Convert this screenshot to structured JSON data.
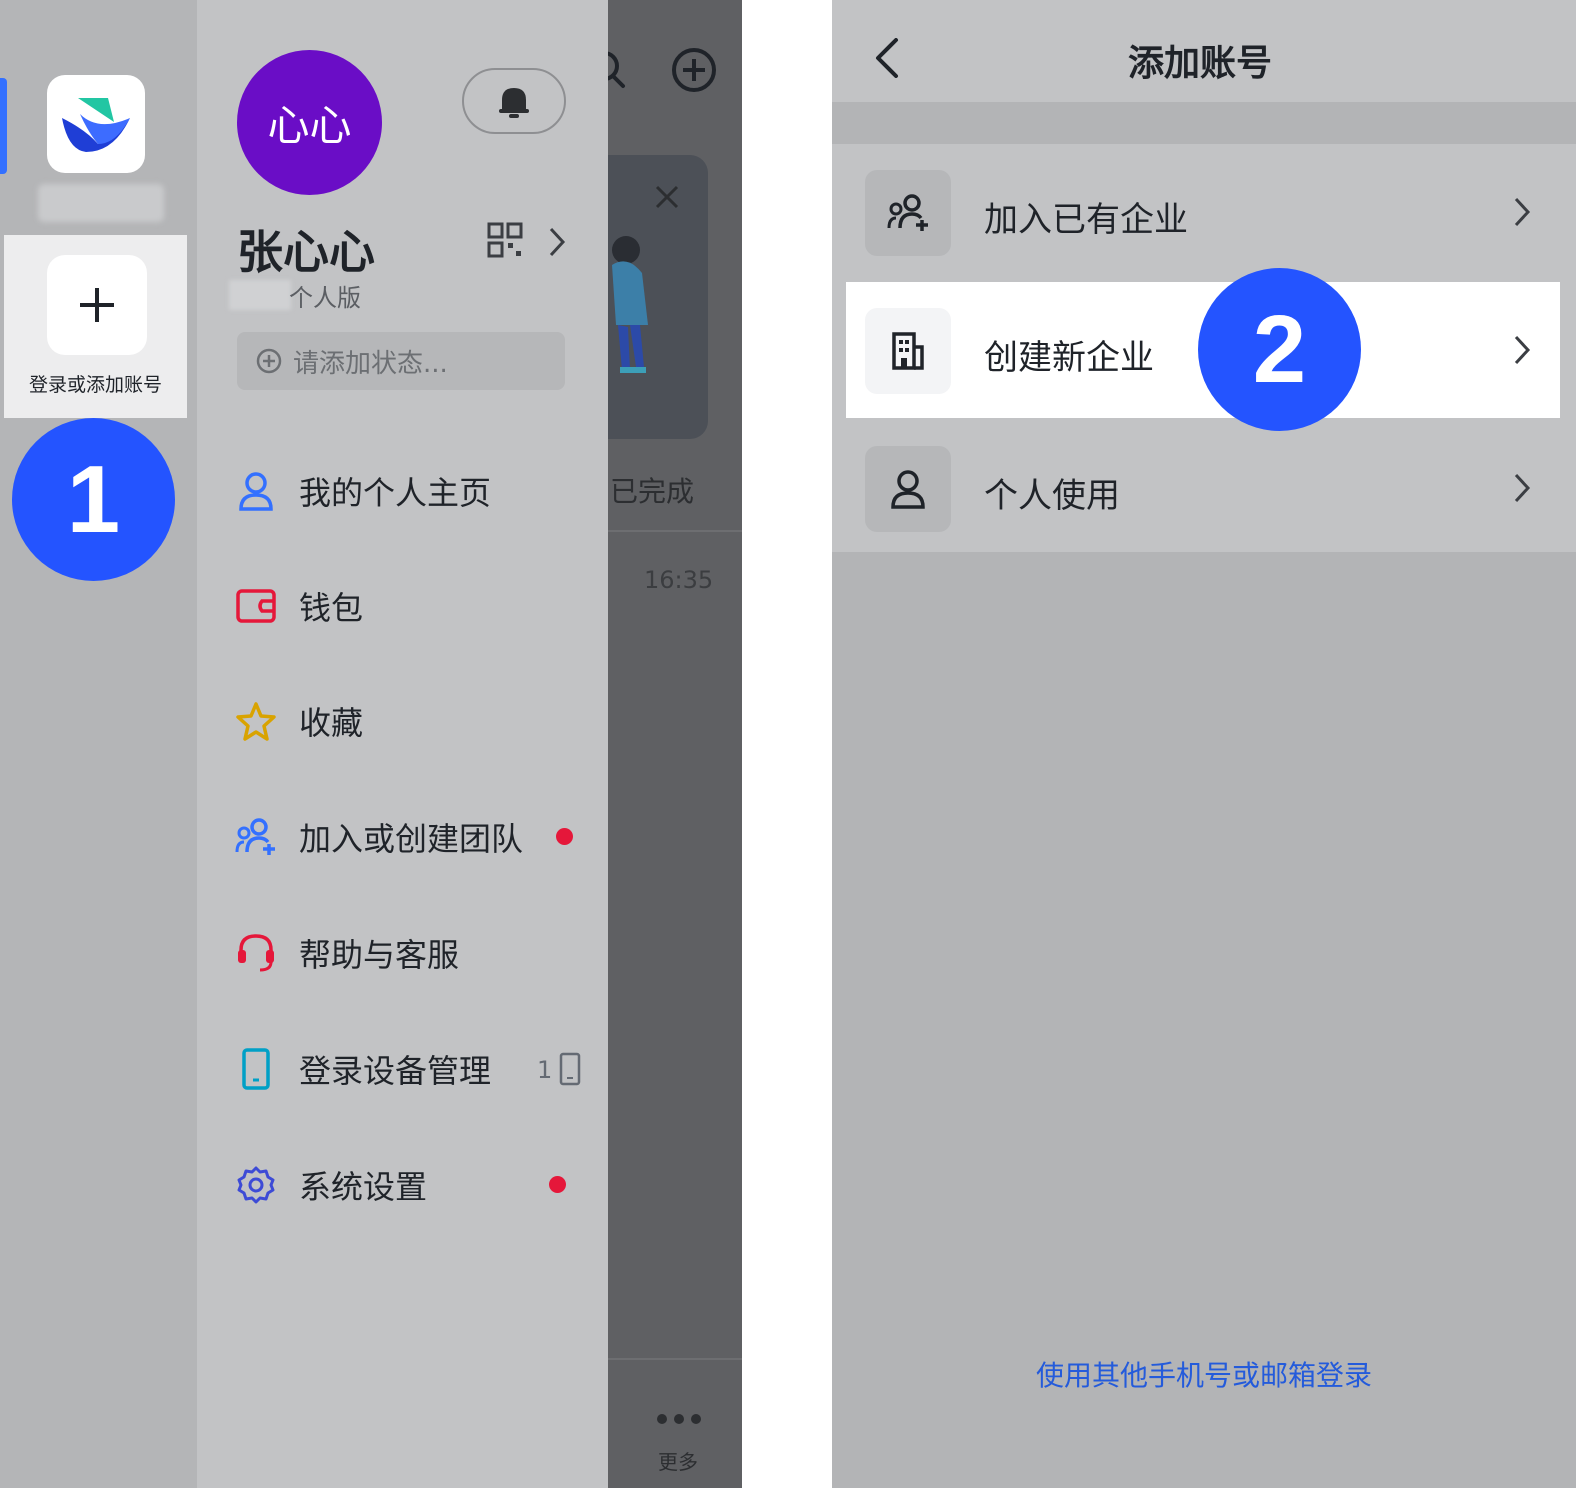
{
  "left_screen": {
    "account_strip": {
      "app_icon": "feishu-logo-icon",
      "add_account_label": "登录或添加账号"
    },
    "drawer": {
      "avatar_text": "心心",
      "user_name": "张心心",
      "edition_label": "个人版",
      "status_placeholder": "请添加状态...",
      "menu": [
        {
          "label": "我的个人主页",
          "icon": "person-icon",
          "color": "#3370ff"
        },
        {
          "label": "钱包",
          "icon": "wallet-icon",
          "color": "#e5173a"
        },
        {
          "label": "收藏",
          "icon": "star-icon",
          "color": "#d9a300"
        },
        {
          "label": "加入或创建团队",
          "icon": "team-add-icon",
          "color": "#3370ff",
          "dot": true
        },
        {
          "label": "帮助与客服",
          "icon": "headset-icon",
          "color": "#e5173a"
        },
        {
          "label": "登录设备管理",
          "icon": "phone-icon",
          "color": "#00a0c6",
          "count": "1"
        },
        {
          "label": "系统设置",
          "icon": "gear-icon",
          "color": "#3d4bd6",
          "dot": true
        }
      ]
    },
    "background": {
      "done_label": "已完成",
      "time": "16:35",
      "more_label": "更多"
    }
  },
  "right_screen": {
    "title": "添加账号",
    "options": [
      {
        "label": "加入已有企业",
        "icon": "team-add-icon"
      },
      {
        "label": "创建新企业",
        "icon": "building-icon",
        "highlighted": true
      },
      {
        "label": "个人使用",
        "icon": "person-icon"
      }
    ],
    "alt_login": "使用其他手机号或邮箱登录"
  },
  "steps": {
    "step1": "1",
    "step2": "2"
  },
  "colors": {
    "accent": "#2454ff",
    "link": "#245bdb",
    "avatar": "#6a0dc6",
    "dot": "#e5173a"
  }
}
